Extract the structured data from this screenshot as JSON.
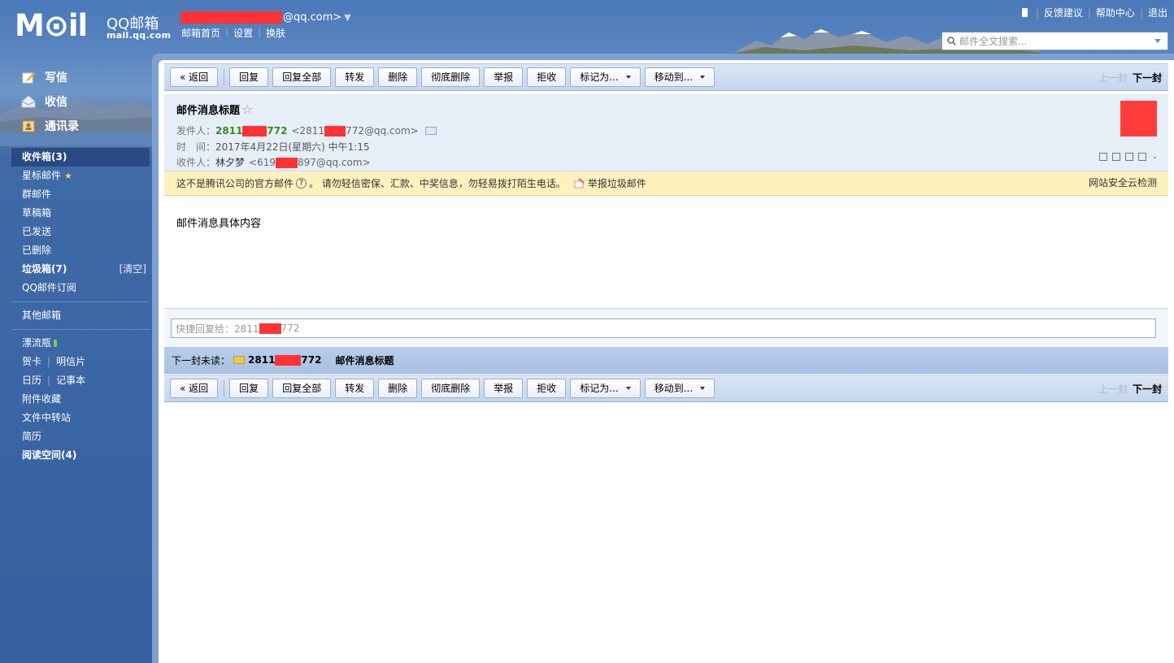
{
  "header": {
    "logo_text": "M⊙il",
    "brand": "QQ邮箱",
    "domain": "mail.qq.com",
    "account_suffix": "@qq.com>",
    "top_links": [
      "邮箱首页",
      "设置",
      "换肤"
    ],
    "right_links": [
      "反馈建议",
      "帮助中心",
      "退出"
    ],
    "search_placeholder": "邮件全文搜索..."
  },
  "sidebar": {
    "actions": [
      "写信",
      "收信",
      "通讯录"
    ],
    "folders": [
      {
        "label": "收件箱(3)"
      },
      {
        "label": "星标邮件"
      },
      {
        "label": "群邮件"
      },
      {
        "label": "草稿箱"
      },
      {
        "label": "已发送"
      },
      {
        "label": "已删除"
      },
      {
        "label": "垃圾箱(7)",
        "extra": "[清空]"
      },
      {
        "label": "QQ邮件订阅"
      }
    ],
    "other": "其他邮箱",
    "apps": {
      "bottle": "漂流瓶",
      "card": "贺卡",
      "postcard": "明信片",
      "calendar": "日历",
      "notes": "记事本",
      "attachments": "附件收藏",
      "transfer": "文件中转站",
      "resume": "简历",
      "reading": "阅读空间(4)"
    }
  },
  "toolbar": {
    "back": "« 返回",
    "reply": "回复",
    "reply_all": "回复全部",
    "forward": "转发",
    "delete": "删除",
    "delete_perm": "彻底删除",
    "report": "举报",
    "reject": "拒收",
    "mark_as": "标记为...",
    "move_to": "移动到...",
    "prev": "上一封",
    "next": "下一封"
  },
  "mail": {
    "title": "邮件消息标题",
    "from_label": "发件人：",
    "from_name_a": "2811",
    "from_name_b": "772",
    "from_addr_a": "<2811",
    "from_addr_b": "772@qq.com>",
    "time_label": "时　间：",
    "time": "2017年4月22日(星期六) 中午1:15",
    "to_label": "收件人：",
    "to_name": "林夕梦",
    "to_addr_a": "<619",
    "to_addr_b": "897@qq.com>",
    "warning_a": "这不是腾讯公司的官方邮件",
    "warning_b": "。  请勿轻信密保、汇款、中奖信息，勿轻易拨打陌生电话。",
    "report_spam": "举报垃圾邮件",
    "security_check": "网站安全云检测",
    "body": "邮件消息具体内容"
  },
  "quick_reply": {
    "prefix": "快捷回复给：2811",
    "suffix": "772"
  },
  "next_unread": {
    "label": "下一封未读：",
    "sender_a": "2811",
    "sender_b": "772",
    "subject": "邮件消息标题"
  },
  "colors": {
    "sender_green": "#3b8a20",
    "redaction": "#ff3333",
    "warning_bg": "#fdf2be"
  }
}
